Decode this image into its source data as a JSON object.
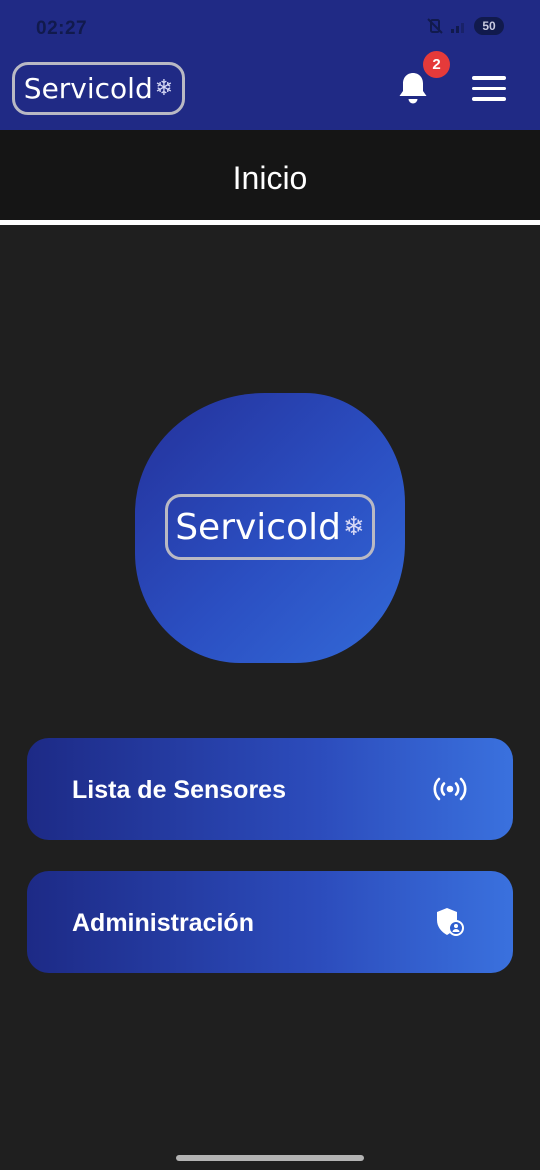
{
  "status_bar": {
    "time": "02:27",
    "battery": "50"
  },
  "header": {
    "logo_text": "Servicold",
    "logo_glyph": "❄",
    "notifications_count": "2",
    "bell_icon": "bell-icon",
    "menu_icon": "hamburger-menu-icon"
  },
  "page": {
    "title": "Inicio"
  },
  "hero": {
    "logo_text": "Servicold",
    "logo_glyph": "❄"
  },
  "actions": [
    {
      "label": "Lista de Sensores",
      "icon": "broadcast-sensor-icon"
    },
    {
      "label": "Administración",
      "icon": "admin-shield-user-icon"
    }
  ],
  "colors": {
    "header_bg": "#202a85",
    "page_bg": "#1f1f1f",
    "badge": "#e53a3a",
    "gradient_start": "#1d2a86",
    "gradient_end": "#3a71de"
  }
}
